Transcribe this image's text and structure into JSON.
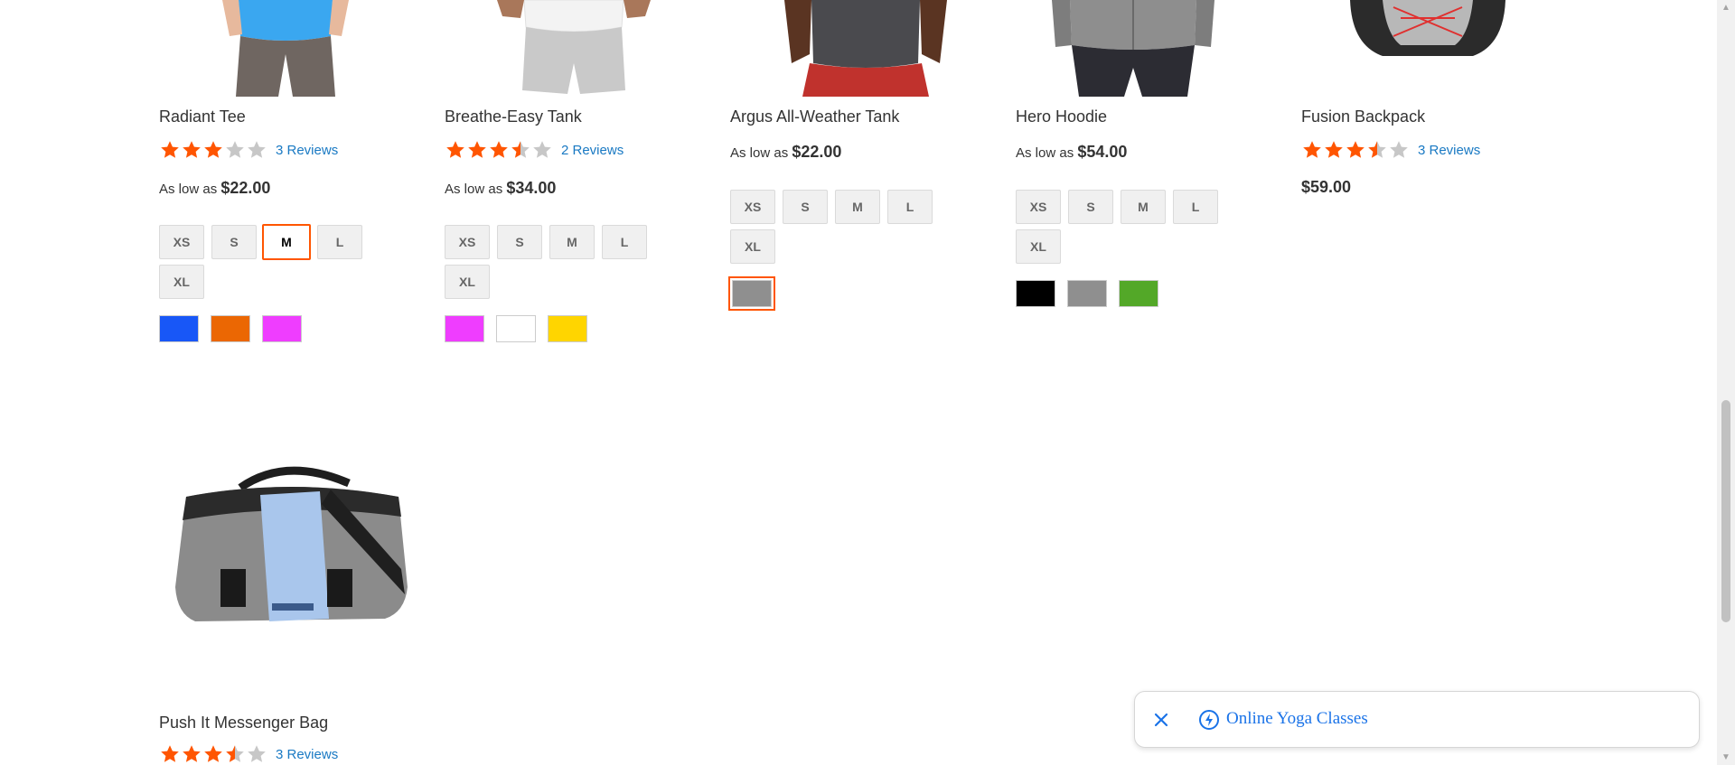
{
  "products": [
    {
      "name": "Radiant Tee",
      "rating_fraction": 0.6,
      "reviews_label": "3 Reviews",
      "price_prefix": "As low as",
      "price": "$22.00",
      "sizes": [
        "XS",
        "S",
        "M",
        "L",
        "XL"
      ],
      "selected_size": "M",
      "colors": [
        "#1857f7",
        "#eb6703",
        "#ef3dff"
      ]
    },
    {
      "name": "Breathe-Easy Tank",
      "rating_fraction": 0.7,
      "reviews_label": "2 Reviews",
      "price_prefix": "As low as",
      "price": "$34.00",
      "sizes": [
        "XS",
        "S",
        "M",
        "L",
        "XL"
      ],
      "colors": [
        "#ef3dff",
        "#ffffff",
        "#ffd500"
      ]
    },
    {
      "name": "Argus All-Weather Tank",
      "price_prefix": "As low as",
      "price": "$22.00",
      "sizes": [
        "XS",
        "S",
        "M",
        "L",
        "XL"
      ],
      "colors": [
        "#8f8f8f"
      ],
      "selected_color": "#8f8f8f"
    },
    {
      "name": "Hero Hoodie",
      "price_prefix": "As low as",
      "price": "$54.00",
      "sizes": [
        "XS",
        "S",
        "M",
        "L",
        "XL"
      ],
      "colors": [
        "#000000",
        "#8f8f8f",
        "#53a828"
      ]
    },
    {
      "name": "Fusion Backpack",
      "rating_fraction": 0.7,
      "reviews_label": "3 Reviews",
      "price": "$59.00"
    },
    {
      "name": "Push It Messenger Bag",
      "rating_fraction": 0.7,
      "reviews_label": "3 Reviews"
    }
  ],
  "floating_panel": {
    "label": "Online Yoga Classes",
    "close_icon": "close-icon",
    "bolt_icon": "bolt-icon"
  },
  "colors": {
    "star_filled": "#ff5501",
    "star_empty": "#c7c7c7",
    "link": "#1979c3",
    "selected_border": "#ff5501"
  }
}
